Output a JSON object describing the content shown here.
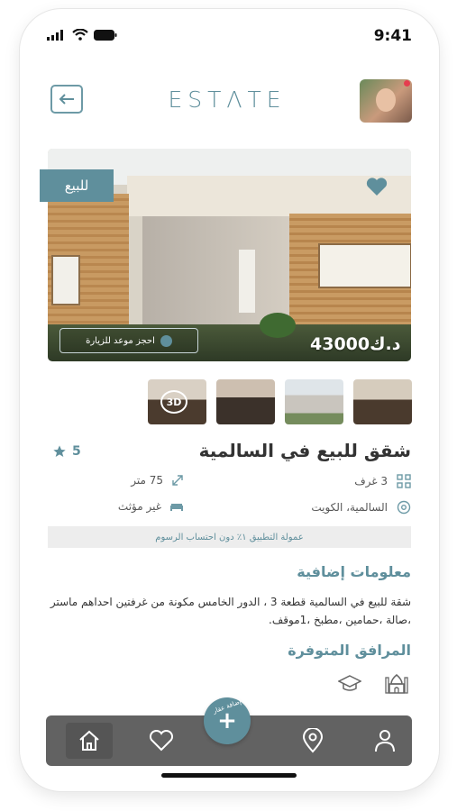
{
  "status_bar": {
    "time": "9:41"
  },
  "header": {
    "logo": "ESTΛTE"
  },
  "listing": {
    "tag": "للبيع",
    "price": "43000د.ك",
    "visit_button": "احجز موعد للزيارة",
    "thumbnail_3d_badge": "3D",
    "title": "شقق للبيع في السالمية",
    "rating": "5",
    "details": {
      "rooms": "3 غرف",
      "area": "75 متر",
      "location": "السالمية، الكويت",
      "furnishing": "غير مؤثث"
    },
    "commission_note": "عمولة التطبيق ١٪ دون احتساب الرسوم"
  },
  "extra_info": {
    "title": "معلومات إضافية",
    "description": "شقة للبيع في السالمية قطعة 3 ، الدور الخامس مكونة من غرفتين احداهم ماستر ،صالة ،حمامين ،مطبخ ،1موقف."
  },
  "facilities": {
    "title": "المرافق المتوفرة",
    "items": [
      "mosque-icon",
      "graduation-cap-icon"
    ]
  },
  "bottom_nav": {
    "items": [
      "home-icon",
      "heart-icon",
      "location-pin-icon",
      "user-icon"
    ],
    "fab_label": "إضافة عقار",
    "fab_symbol": "+"
  },
  "colors": {
    "accent": "#5f8f9c",
    "nav_bg": "#626262"
  }
}
